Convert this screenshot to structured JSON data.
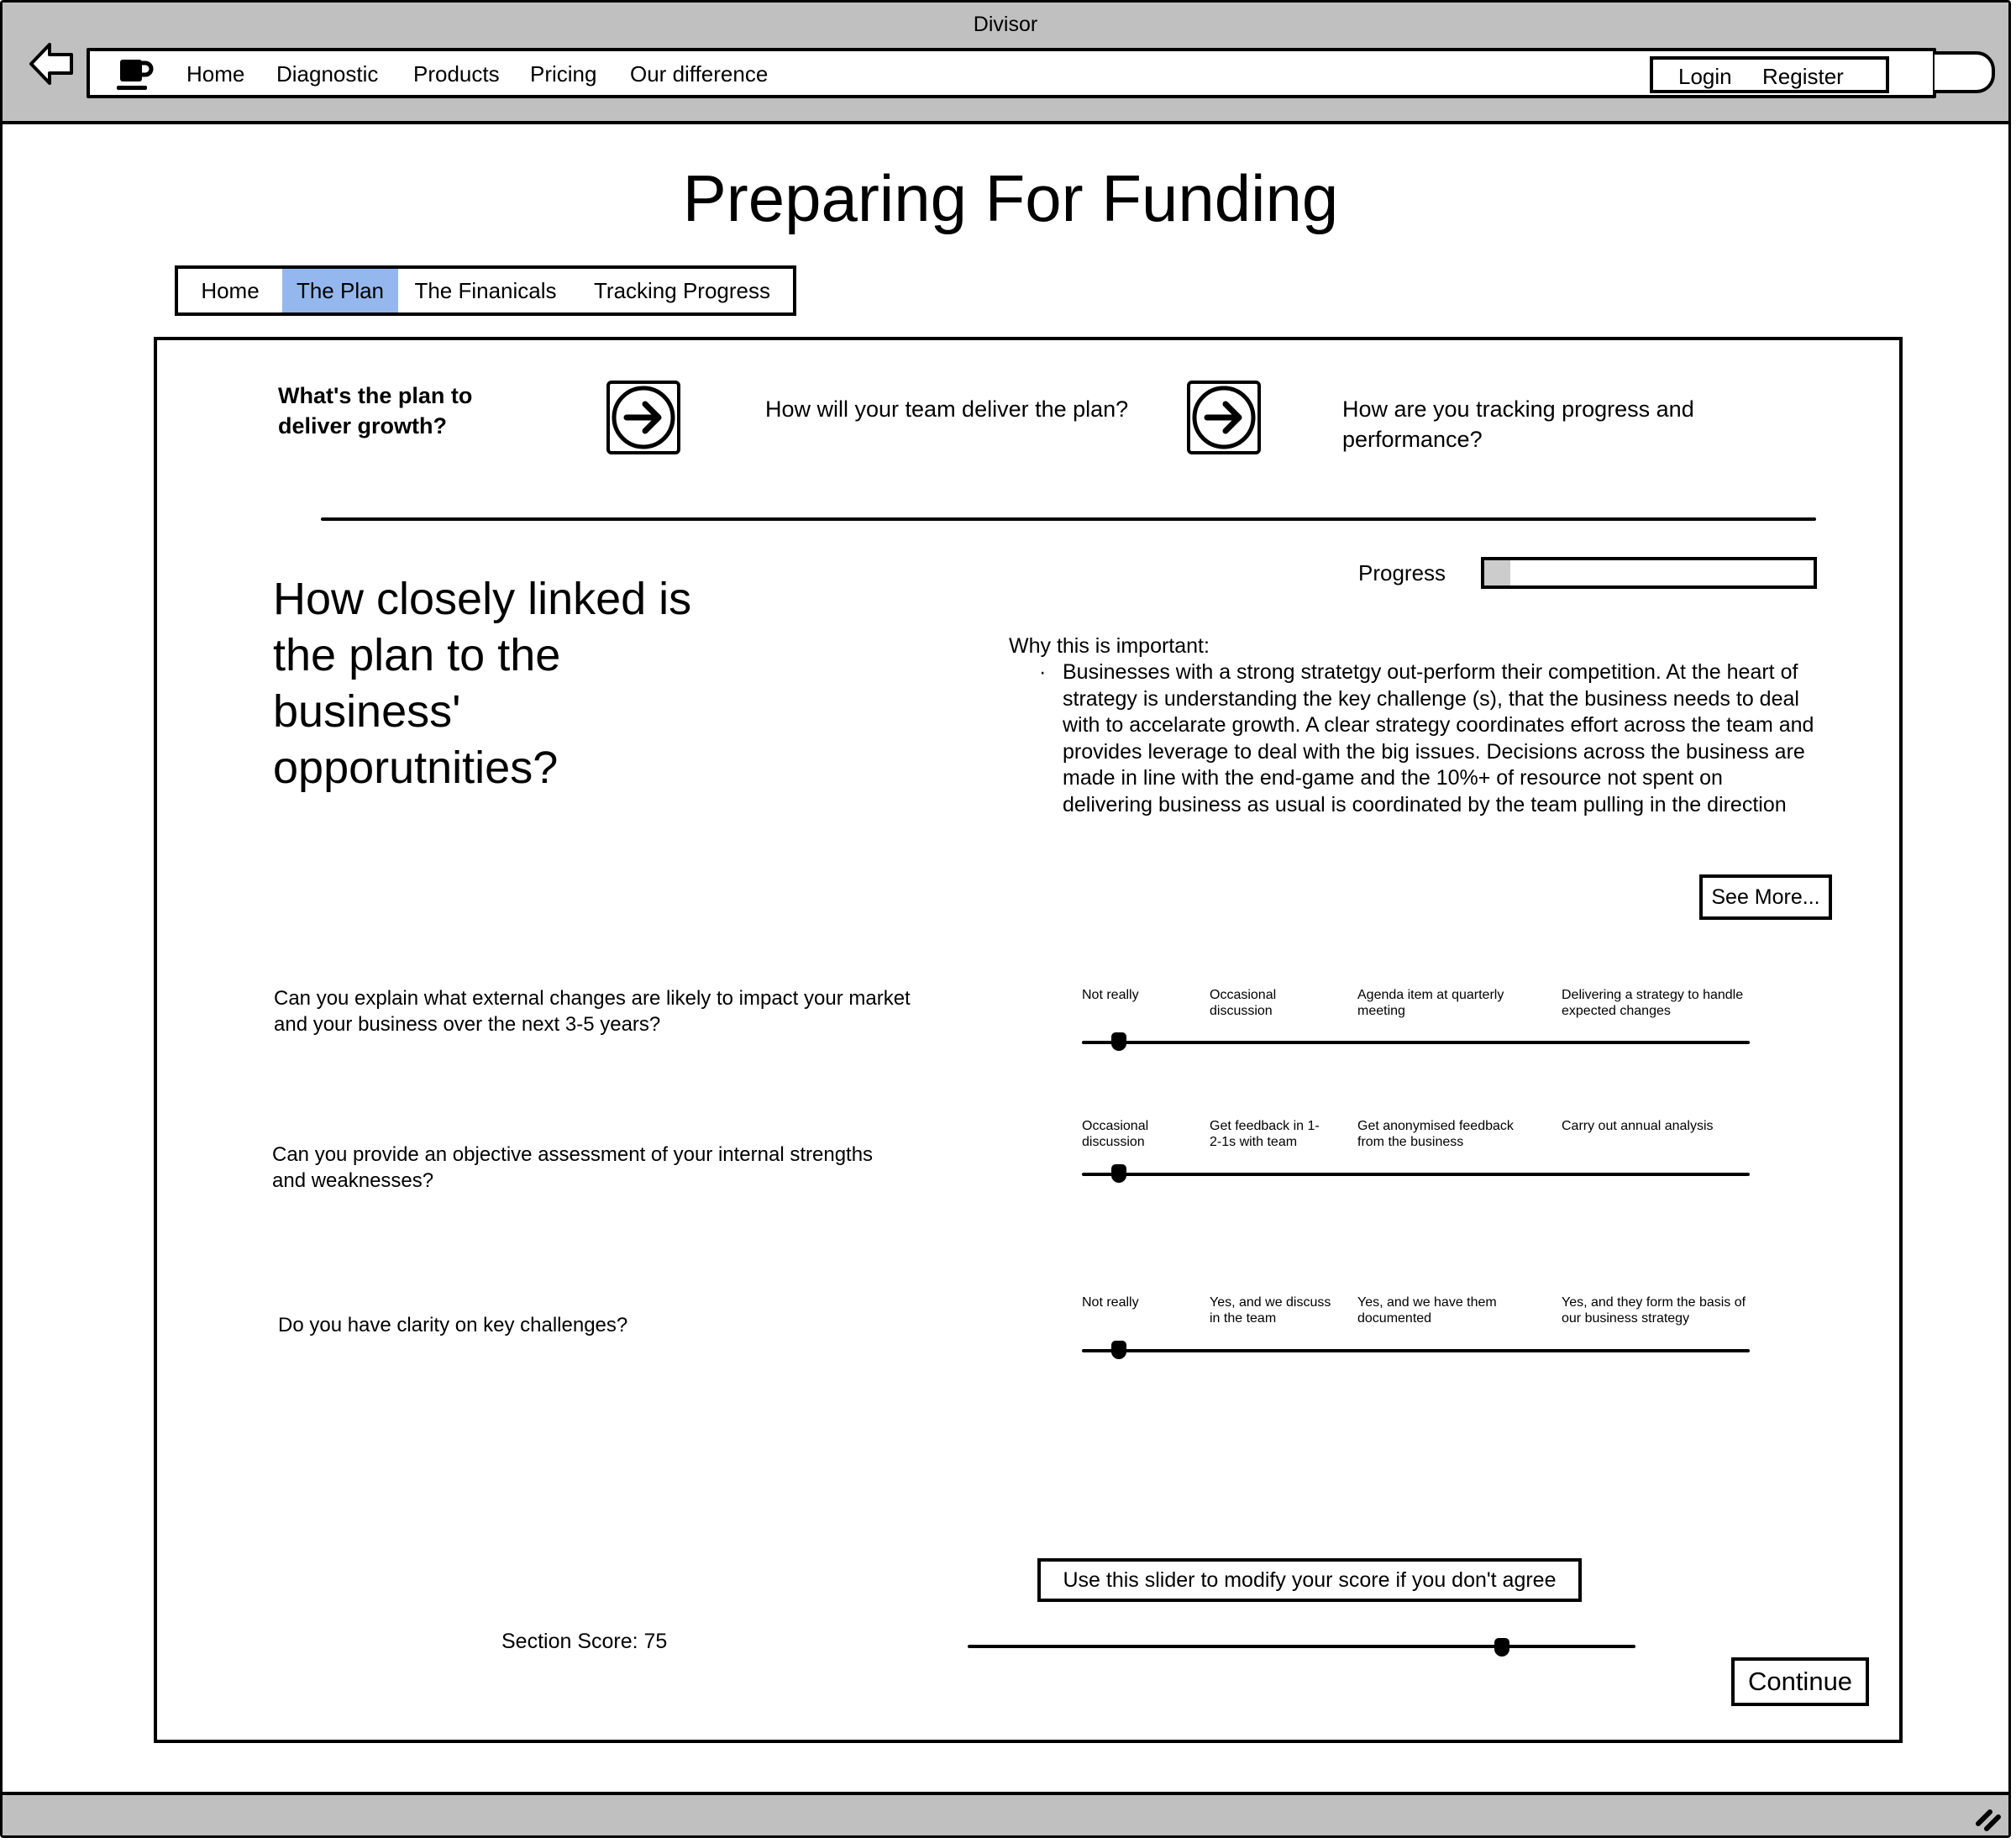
{
  "window": {
    "title": "Divisor"
  },
  "navbar": {
    "logo_icon": "coffee-cup-icon",
    "links": [
      {
        "label": "Home"
      },
      {
        "label": "Diagnostic"
      },
      {
        "label": "Products"
      },
      {
        "label": "Pricing"
      },
      {
        "label": "Our difference"
      }
    ],
    "login_label": "Login",
    "register_label": "Register"
  },
  "page": {
    "heading": "Preparing For Funding"
  },
  "tabs": [
    {
      "label": "Home",
      "active": false
    },
    {
      "label": "The Plan",
      "active": true
    },
    {
      "label": "The Finanicals",
      "active": false
    },
    {
      "label": "Tracking Progress",
      "active": false
    }
  ],
  "steps": [
    {
      "label": "What's the plan to deliver growth?",
      "current": true
    },
    {
      "label": "How will your team deliver the plan?",
      "current": false
    },
    {
      "label": "How are you tracking progress and performance?",
      "current": false
    }
  ],
  "progress": {
    "label": "Progress",
    "value_percent": 8
  },
  "main_question": "How closely linked is the plan to the business' opporutnities?",
  "why": {
    "label": "Why this is important:",
    "bullets": [
      "Businesses with a strong stratetgy out-perform their competition. At the heart of strategy is understanding the key challenge (s), that the business needs to deal with to accelarate growth. A clear strategy coordinates effort across the team and provides leverage to deal with the big issues. Decisions across the business are made in line with the end-game and the 10%+ of resource not spent on delivering business as usual is coordinated by the team pulling in the direction"
    ],
    "see_more_label": "See More..."
  },
  "questions": [
    {
      "text": "Can you explain what external changes are likely to impact your market and your business over the next 3-5 years?",
      "options": [
        "Not really",
        "Occasional discussion",
        "Agenda item at quarterly meeting",
        "Delivering a strategy to handle expected changes"
      ],
      "selected_index": 0
    },
    {
      "text": "Can you provide an objective assessment of your internal strengths and weaknesses?",
      "options": [
        "Occasional discussion",
        "Get feedback in 1-2-1s with team",
        "Get anonymised feedback from the business",
        "Carry out annual analysis"
      ],
      "selected_index": 0
    },
    {
      "text": "Do you have clarity on key challenges?",
      "options": [
        "Not really",
        "Yes, and we discuss in the team",
        "Yes, and we have them documented",
        "Yes, and they form the basis of our business strategy"
      ],
      "selected_index": 0
    }
  ],
  "score": {
    "hint": "Use this slider to modify your score if you don't agree",
    "label": "Section Score: 75",
    "value": 75,
    "slider_percent": 80
  },
  "continue_label": "Continue"
}
